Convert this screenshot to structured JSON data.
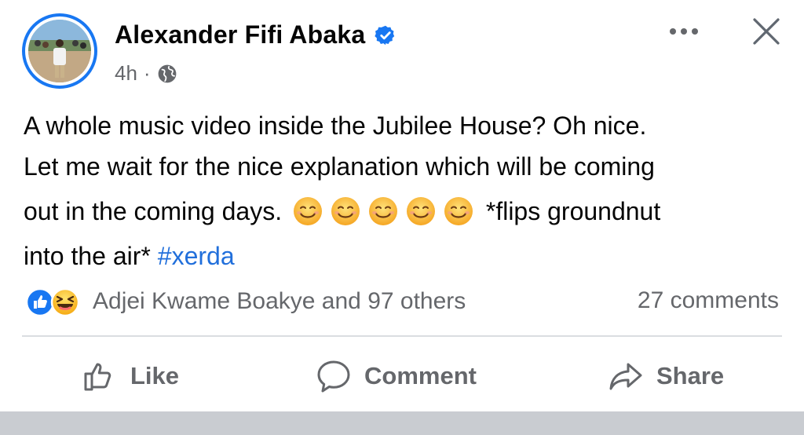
{
  "post": {
    "author": "Alexander Fifi Abaka",
    "time": "4h",
    "separator": "·",
    "verified_icon": "verified-badge-icon",
    "audience_icon": "globe-icon",
    "text": {
      "line1": "A whole music video inside the Jubilee House? Oh nice.",
      "line2": "Let me wait for the nice explanation which will be coming",
      "line3_before": "out in the coming days.",
      "emoji_count": 5,
      "line3_after": "*flips groundnut",
      "line4_before": "into the air*",
      "hashtag": "#xerda"
    }
  },
  "engagement": {
    "reactors": "Adjei Kwame Boakye and 97 others",
    "comments": "27 comments",
    "reaction_icons": [
      "like-reaction-icon",
      "haha-reaction-icon"
    ]
  },
  "actions": {
    "like": "Like",
    "comment": "Comment",
    "share": "Share"
  },
  "colors": {
    "accent": "#1877f2",
    "hashtag": "#216fdb",
    "muted": "#65676b"
  }
}
